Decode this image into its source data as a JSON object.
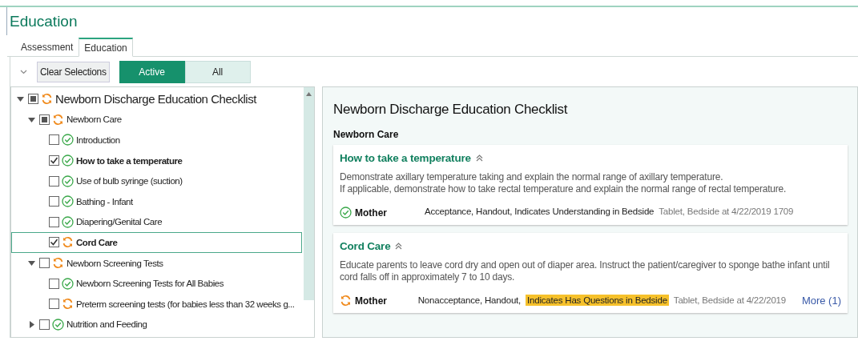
{
  "title": "Education",
  "tabs": [
    {
      "label": "Assessment",
      "selected": false
    },
    {
      "label": "Education",
      "selected": true
    }
  ],
  "toolbar": {
    "clear_button": "Clear Selections",
    "filters": [
      {
        "label": "Active",
        "selected": true
      },
      {
        "label": "All",
        "selected": false
      }
    ]
  },
  "tree": [
    {
      "label": "Newborn Discharge Education Checklist",
      "checked": false,
      "partial": true,
      "complete": false,
      "expanded": true,
      "selected": false,
      "children": [
        {
          "label": "Newborn Care",
          "checked": false,
          "partial": true,
          "complete": false,
          "expanded": true,
          "selected": false,
          "children": [
            {
              "label": "Introduction",
              "checked": false,
              "partial": false,
              "complete": true,
              "selected": false
            },
            {
              "label": "How to take a temperature",
              "checked": true,
              "partial": false,
              "complete": true,
              "selected": false
            },
            {
              "label": "Use of bulb syringe (suction)",
              "checked": false,
              "partial": false,
              "complete": true,
              "selected": false
            },
            {
              "label": "Bathing - Infant",
              "checked": false,
              "partial": false,
              "complete": true,
              "selected": false
            },
            {
              "label": "Diapering/Genital Care",
              "checked": false,
              "partial": false,
              "complete": true,
              "selected": false
            },
            {
              "label": "Cord Care",
              "checked": true,
              "partial": false,
              "complete": false,
              "selected": true
            }
          ]
        },
        {
          "label": "Newborn Screening Tests",
          "checked": false,
          "partial": false,
          "complete": false,
          "expanded": true,
          "selected": false,
          "children": [
            {
              "label": "Newborn Screening Tests for All Babies",
              "checked": false,
              "partial": false,
              "complete": true,
              "selected": false
            },
            {
              "label": "Preterm screening tests (for babies less than 32 weeks g...",
              "checked": false,
              "partial": false,
              "complete": false,
              "selected": false
            }
          ]
        },
        {
          "label": "Nutrition and Feeding",
          "checked": false,
          "partial": false,
          "complete": true,
          "expanded": false,
          "selected": false
        }
      ]
    }
  ],
  "detail": {
    "heading": "Newborn Discharge Education Checklist",
    "section": "Newborn Care",
    "cards": [
      {
        "title": "How to take a temperature",
        "description": [
          "Demonstrate axillary temperature taking and explain the normal range of axillary temperature.",
          "If applicable, demonstrate how to take rectal temperature and explain the normal range of rectal temperature."
        ],
        "response": {
          "complete": true,
          "person": "Mother",
          "parts": [
            {
              "text": "Acceptance, Handout, Indicates Understanding in Bedside",
              "highlight": false
            }
          ],
          "meta": "Tablet, Bedside at 4/22/2019 1709"
        }
      },
      {
        "title": "Cord Care",
        "description": [
          "Educate parents to leave cord dry and open out of diaper area. Instruct the patient/caregiver to sponge bathe infant until cord falls off in approximately 7 to 10 days."
        ],
        "response": {
          "complete": false,
          "person": "Mother",
          "parts": [
            {
              "text": "Nonacceptance, Handout,",
              "highlight": false
            },
            {
              "text": "Indicates Has Questions in Bedside",
              "highlight": true
            }
          ],
          "meta": "Tablet, Bedside at 4/22/2019",
          "more": "More (1)"
        }
      }
    ]
  }
}
